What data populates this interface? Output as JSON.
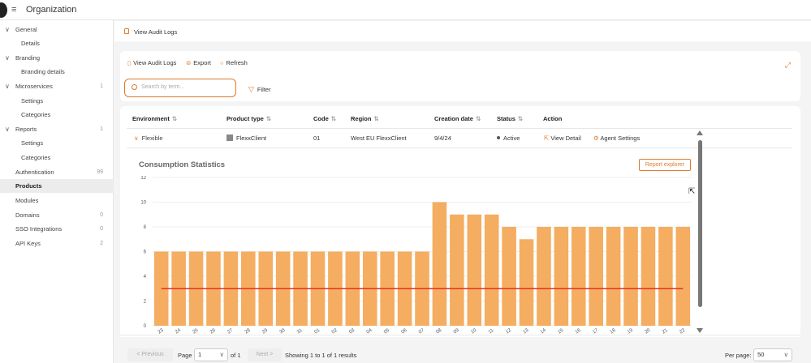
{
  "header": {
    "title": "Organization"
  },
  "sidebar": {
    "items": [
      {
        "label": "General",
        "chev": "∨",
        "count": "",
        "child": false
      },
      {
        "label": "Details",
        "chev": "",
        "count": "",
        "child": true
      },
      {
        "label": "Branding",
        "chev": "∨",
        "count": "",
        "child": false
      },
      {
        "label": "Branding details",
        "chev": "",
        "count": "",
        "child": true
      },
      {
        "label": "Microservices",
        "chev": "∨",
        "count": "1",
        "child": false
      },
      {
        "label": "Settings",
        "chev": "",
        "count": "",
        "child": true
      },
      {
        "label": "Categories",
        "chev": "",
        "count": "",
        "child": true
      },
      {
        "label": "Reports",
        "chev": "∨",
        "count": "1",
        "child": false
      },
      {
        "label": "Settings",
        "chev": "",
        "count": "",
        "child": true
      },
      {
        "label": "Categories",
        "chev": "",
        "count": "",
        "child": true
      },
      {
        "label": "Authentication",
        "chev": "",
        "count": "99",
        "child": false
      },
      {
        "label": "Products",
        "chev": "",
        "count": "",
        "child": false,
        "active": true
      },
      {
        "label": "Modules",
        "chev": "",
        "count": "",
        "child": false
      },
      {
        "label": "Domains",
        "chev": "",
        "count": "0",
        "child": false
      },
      {
        "label": "SSO Integrations",
        "chev": "",
        "count": "0",
        "child": false
      },
      {
        "label": "API Keys",
        "chev": "",
        "count": "2",
        "child": false
      }
    ]
  },
  "breadcrumb": {
    "label": "View Audit Logs"
  },
  "toolbar": {
    "view_audit": "View Audit Logs",
    "export": "Export",
    "refresh": "Refresh",
    "search_placeholder": "Search by term...",
    "filter": "Filter"
  },
  "table": {
    "headers": [
      "Environment",
      "Product type",
      "Code",
      "Region",
      "Creation date",
      "Status",
      "Action"
    ],
    "row": {
      "environment": "Flexible",
      "product_type": "FlexxClient",
      "code": "01",
      "region": "West EU FlexxClient",
      "creation_date": "9/4/24",
      "status": "Active",
      "view_detail": "View Detail",
      "agent_settings": "Agent Settings"
    }
  },
  "chart_title": "Consumption Statistics",
  "report_button": "Report explorer",
  "chart_data": {
    "type": "bar",
    "categories": [
      "23",
      "24",
      "25",
      "26",
      "27",
      "28",
      "29",
      "30",
      "31",
      "01",
      "02",
      "03",
      "04",
      "05",
      "06",
      "07",
      "08",
      "09",
      "10",
      "11",
      "12",
      "13",
      "14",
      "15",
      "16",
      "17",
      "18",
      "19",
      "20",
      "21",
      "22"
    ],
    "values": [
      6,
      6,
      6,
      6,
      6,
      6,
      6,
      6,
      6,
      6,
      6,
      6,
      6,
      6,
      6,
      6,
      10,
      9,
      9,
      9,
      8,
      7,
      8,
      8,
      8,
      8,
      8,
      8,
      8,
      8,
      8
    ],
    "reference_line": 3,
    "yticks": [
      0,
      2,
      4,
      6,
      8,
      10,
      12
    ],
    "ylim": [
      0,
      12
    ],
    "bar_color": "#f4ad61",
    "line_color": "#e8321f"
  },
  "pagination": {
    "previous": "< Previous",
    "page_label": "Page",
    "page_value": "1",
    "of_label": "of 1",
    "next": "Next >",
    "showing": "Showing 1 to 1 of 1 results",
    "per_page_label": "Per page:",
    "per_page_value": "50"
  },
  "colors": {
    "accent": "#e07a2a"
  }
}
